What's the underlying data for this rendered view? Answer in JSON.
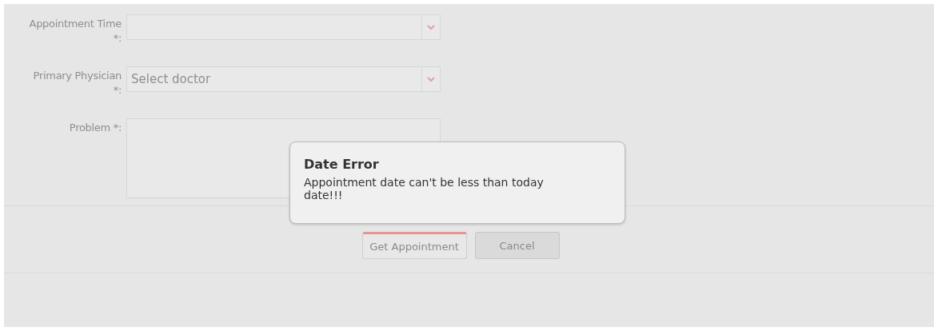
{
  "form": {
    "disabled": true,
    "fields": [
      {
        "kind": "select",
        "label": "Appointment Time *:"
      },
      {
        "kind": "select",
        "label": "Primary Physician *:",
        "placeholder": "Select doctor"
      },
      {
        "kind": "textarea",
        "label": "Problem *:"
      }
    ]
  },
  "buttons": [
    {
      "label": "Get Appointment",
      "focused": true
    },
    {
      "label": "Cancel",
      "focused": false
    }
  ],
  "dialog": {
    "title": "Date Error",
    "message": "Appointment date can't be less than today date!!!"
  }
}
